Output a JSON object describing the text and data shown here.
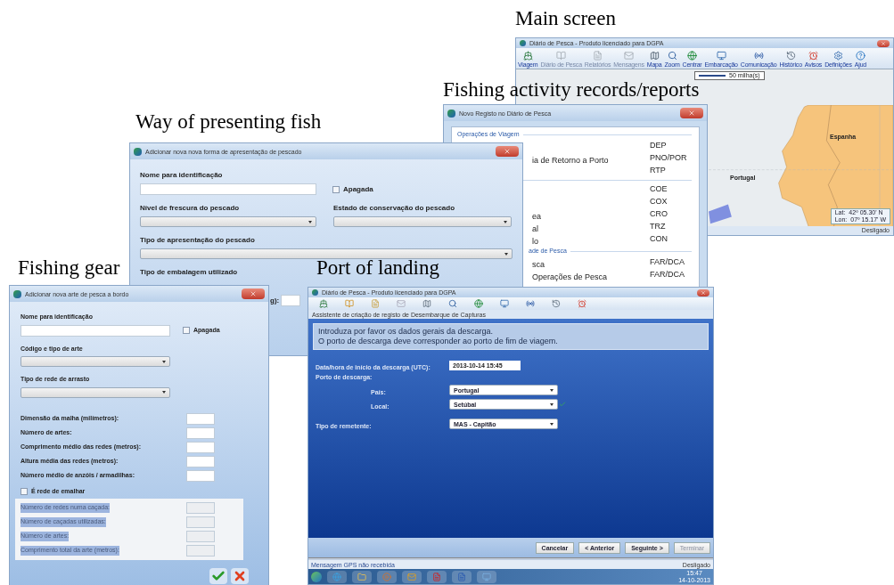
{
  "main_screen": {
    "caption": "Main screen",
    "title": "Diário de Pesca - Produto licenciado para DGPA",
    "toolbar": [
      {
        "label": "Viagem",
        "disabled": false
      },
      {
        "label": "Diário de Pesca",
        "disabled": true
      },
      {
        "label": "Relatórios",
        "disabled": true
      },
      {
        "label": "Mensagens",
        "disabled": true
      },
      {
        "label": "Mapa",
        "disabled": false
      },
      {
        "label": "Zoom",
        "disabled": false
      },
      {
        "label": "Centrar",
        "disabled": false
      },
      {
        "label": "Embarcação",
        "disabled": false
      },
      {
        "label": "Comunicação",
        "disabled": false
      },
      {
        "label": "Histórico",
        "disabled": false
      },
      {
        "label": "Avisos",
        "disabled": false
      },
      {
        "label": "Definições",
        "disabled": false
      },
      {
        "label": "Ajud",
        "disabled": false
      }
    ],
    "scale": "50 milha(s)",
    "map_labels": [
      "Portugal",
      "Espanha"
    ],
    "coords": [
      {
        "label": "Lat:",
        "value": "42º 05.30' N"
      },
      {
        "label": "Lon:",
        "value": "07º 15.17' W"
      }
    ],
    "status": "Desligado"
  },
  "activity": {
    "caption": "Fishing activity records/reports",
    "title": "Novo Registo no Diário de Pesca",
    "sections": [
      {
        "label": "Operações de Viagem",
        "rows": [
          {
            "code": "DEP"
          },
          {
            "text": "ia de Retorno a Porto",
            "code": "PNO/POR"
          },
          {
            "code": "RTP"
          }
        ]
      },
      {
        "rows": [
          {
            "code": "COE"
          },
          {
            "code": "COX"
          },
          {
            "text": "ea",
            "code": "CRO"
          },
          {
            "text": "al",
            "code": "TRZ"
          },
          {
            "text": "lo",
            "code": "CON"
          }
        ]
      },
      {
        "label": "ade de Pesca",
        "rows": [
          {
            "text": "sca",
            "code": "FAR/DCA"
          },
          {
            "text": "Operações de Pesca",
            "code": "FAR/DCA"
          }
        ]
      }
    ]
  },
  "fish_form": {
    "caption": "Way of presenting fish",
    "title": "Adicionar nova nova forma de apresentação de pescado",
    "name_label": "Nome para identificação",
    "deleted": {
      "label": "Apagada",
      "checked": false
    },
    "freshness_label": "Nível de frescura do pescado",
    "conservation_label": "Estado de conservação do pescado",
    "presentation_label": "Tipo de apresentação do pescado",
    "packaging_label": "Tipo de embalagem utilizado",
    "weight_label_end": "g):"
  },
  "gear_form": {
    "caption": "Fishing gear",
    "title": "Adicionar nova arte de pesca a bordo",
    "name_label": "Nome para identificação",
    "deleted": {
      "label": "Apagada",
      "checked": false
    },
    "selects": [
      "Código e tipo de arte",
      "Tipo de rede de arrasto"
    ],
    "numeric_fields": [
      "Dimensão da malha (milímetros):",
      "Número de artes:",
      "Comprimento médio das redes (metros):",
      "Altura média das redes (metros):",
      "Número médio de anzóis / armadilhas:"
    ],
    "gillnet": {
      "label": "É rede de emalhar",
      "checked": false
    },
    "gillnet_fields": [
      "Número de redes numa caçada:",
      "Número de caçadas utilizadas:",
      "Número de artes:",
      "Comprimento total da arte (metros):"
    ]
  },
  "port_landing": {
    "caption": "Port of landing",
    "title": "Diário de Pesca - Produto licenciado para DGPA",
    "wizard_title": "Assistente de criação de registo de Desembarque de Capturas",
    "instructions": [
      "Introduza por favor os dados gerais da descarga.",
      "O porto de descarga deve corresponder ao porto de fim de viagem."
    ],
    "start_label": "Data/hora de início da descarga (UTC):",
    "start_value": "2013-10-14 15:45",
    "port_label": "Porto de descarga:",
    "country": {
      "label": "País:",
      "value": "Portugal"
    },
    "place": {
      "label": "Local:",
      "value": "Setúbal",
      "valid": true
    },
    "sender": {
      "label": "Tipo de remetente:",
      "value": "MAS - Capitão"
    },
    "buttons": [
      {
        "label": "Cancelar",
        "disabled": false
      },
      {
        "label": "< Anterior",
        "disabled": false
      },
      {
        "label": "Seguinte >",
        "disabled": false
      },
      {
        "label": "Terminar",
        "disabled": true
      }
    ],
    "status_left": "Mensagem GPS não recebida",
    "status_right": "Desligado",
    "clock": {
      "time": "15:47",
      "date": "14-10-2013"
    }
  }
}
